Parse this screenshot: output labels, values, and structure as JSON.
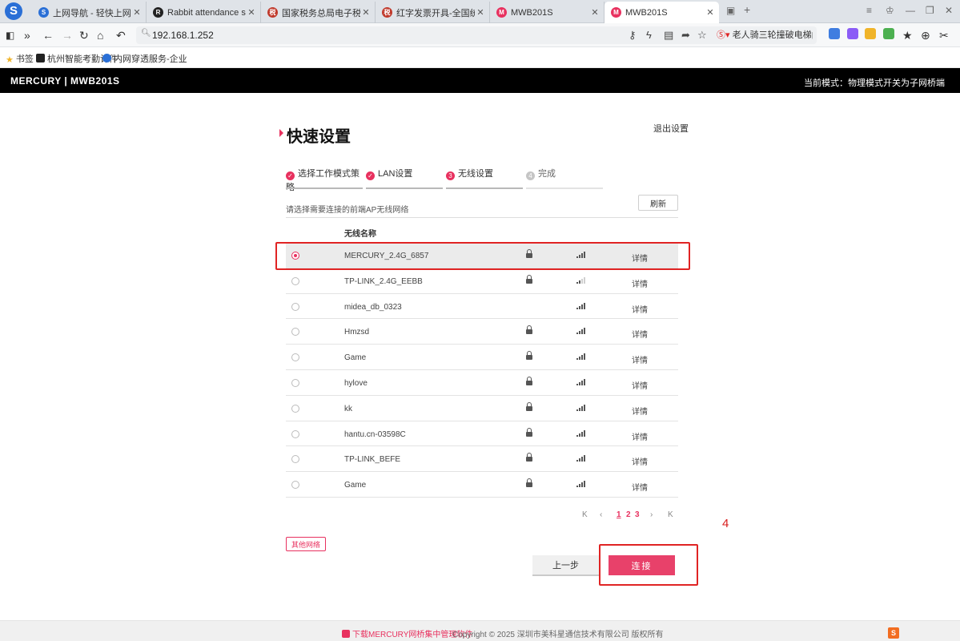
{
  "browser": {
    "tabs": [
      {
        "label": "上网导航 - 轻快上网 从这里开始",
        "favicon_color": "#2a6fd6"
      },
      {
        "label": "Rabbit attendance software",
        "favicon_color": "#222222"
      },
      {
        "label": "国家税务总局电子税务局",
        "favicon_color": "#c0392b"
      },
      {
        "label": "红字发票开具-全国统一规范电子",
        "favicon_color": "#c0392b"
      },
      {
        "label": "MWB201S",
        "favicon_color": "#e8315f"
      },
      {
        "label": "MWB201S",
        "favicon_color": "#e8315f"
      }
    ],
    "address": "192.168.1.252",
    "search_hint": "老人骑三轮撞破电梯门掉",
    "bookmarks": [
      "书签",
      "杭州智能考勤计件",
      "内网穿透服务-企业"
    ]
  },
  "router": {
    "brand": "MERCURY | MWB201S",
    "mode_text": "当前模式：物理模式开关为子网桥端"
  },
  "page": {
    "title": "快速设置",
    "exit_label": "退出设置",
    "steps": [
      {
        "label": "选择工作模式策略",
        "state": "done"
      },
      {
        "label": "LAN设置",
        "state": "done"
      },
      {
        "label": "无线设置",
        "state": "current",
        "num": "3"
      },
      {
        "label": "完成",
        "state": "todo",
        "num": "4"
      }
    ],
    "prompt": "请选择需要连接的前端AP无线网络",
    "refresh_label": "刷新",
    "table_header": "无线名称",
    "networks": [
      {
        "ssid": "MERCURY_2.4G_6857",
        "locked": true,
        "signal": 4,
        "detail": "详情",
        "selected": true
      },
      {
        "ssid": "TP-LINK_2.4G_EEBB",
        "locked": true,
        "signal": 2,
        "detail": "详情",
        "selected": false
      },
      {
        "ssid": "midea_db_0323",
        "locked": false,
        "signal": 4,
        "detail": "详情",
        "selected": false
      },
      {
        "ssid": "Hmzsd",
        "locked": true,
        "signal": 4,
        "detail": "详情",
        "selected": false
      },
      {
        "ssid": "Game",
        "locked": true,
        "signal": 4,
        "detail": "详情",
        "selected": false
      },
      {
        "ssid": "hylove",
        "locked": true,
        "signal": 4,
        "detail": "详情",
        "selected": false
      },
      {
        "ssid": "kk",
        "locked": true,
        "signal": 4,
        "detail": "详情",
        "selected": false
      },
      {
        "ssid": "hantu.cn-03598C",
        "locked": true,
        "signal": 4,
        "detail": "详情",
        "selected": false
      },
      {
        "ssid": "TP-LINK_BEFE",
        "locked": true,
        "signal": 4,
        "detail": "详情",
        "selected": false
      },
      {
        "ssid": "Game",
        "locked": true,
        "signal": 4,
        "detail": "详情",
        "selected": false
      }
    ],
    "pager": {
      "first": "K",
      "prev": "‹",
      "pages": [
        "1",
        "2",
        "3"
      ],
      "current": "1",
      "next": "›",
      "last": "K"
    },
    "other_network_label": "其他网络",
    "prev_label": "上一步",
    "connect_label": "连接",
    "annotation_number": "4"
  },
  "footer": {
    "download_label": "下载MERCURY网桥集中管理软件",
    "copyright": "Copyright © 2025 深圳市美科星通信技术有限公司 版权所有"
  },
  "colors": {
    "accent": "#e8315f",
    "annotation": "#e02424"
  }
}
